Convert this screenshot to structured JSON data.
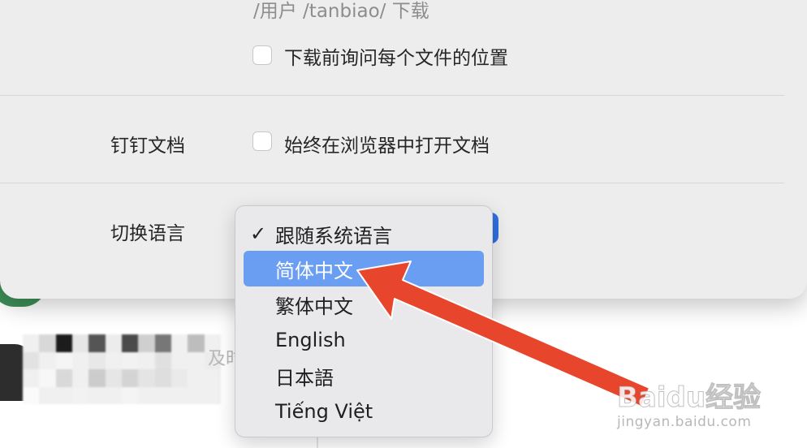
{
  "settings": {
    "download_path": "/用户 /tanbiao/ 下载",
    "ask_download_location_label": "下载前询问每个文件的位置",
    "dingtalk_docs_label": "钉钉文档",
    "open_in_browser_label": "始终在浏览器中打开文档",
    "switch_language_label": "切换语言"
  },
  "language_menu": {
    "items": [
      {
        "label": "跟随系统语言",
        "checked": true
      },
      {
        "label": "简体中文",
        "highlighted": true
      },
      {
        "label": "繁体中文"
      },
      {
        "label": "English"
      },
      {
        "label": "日本語"
      },
      {
        "label": "Tiếng Việt"
      }
    ]
  },
  "background": {
    "partial_text": "及时"
  },
  "watermark": {
    "logo": "Baidu经验",
    "url": "jingyan.baidu.com"
  },
  "colors": {
    "sheet_bg": "#ededed",
    "menu_bg": "#e9e9eb",
    "highlight": "#6a9ef3",
    "select_accent": "#2f6fe0",
    "arrow_red": "#e8452d"
  }
}
